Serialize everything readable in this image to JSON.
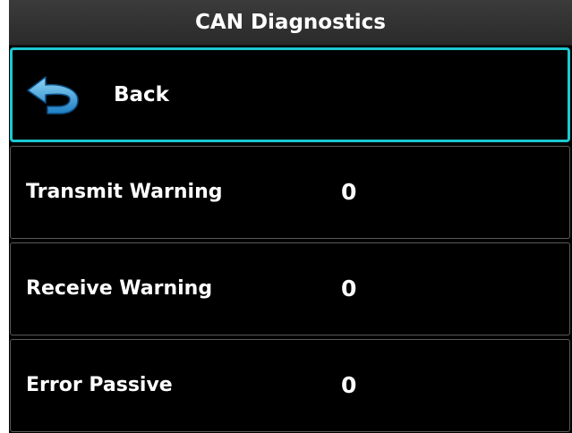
{
  "header": {
    "title": "CAN Diagnostics"
  },
  "back": {
    "label": "Back",
    "icon": "back-arrow-icon",
    "accent_color": "#1cc8d0"
  },
  "rows": [
    {
      "label": "Transmit Warning",
      "value": "0"
    },
    {
      "label": "Receive Warning",
      "value": "0"
    },
    {
      "label": "Error Passive",
      "value": "0"
    }
  ]
}
